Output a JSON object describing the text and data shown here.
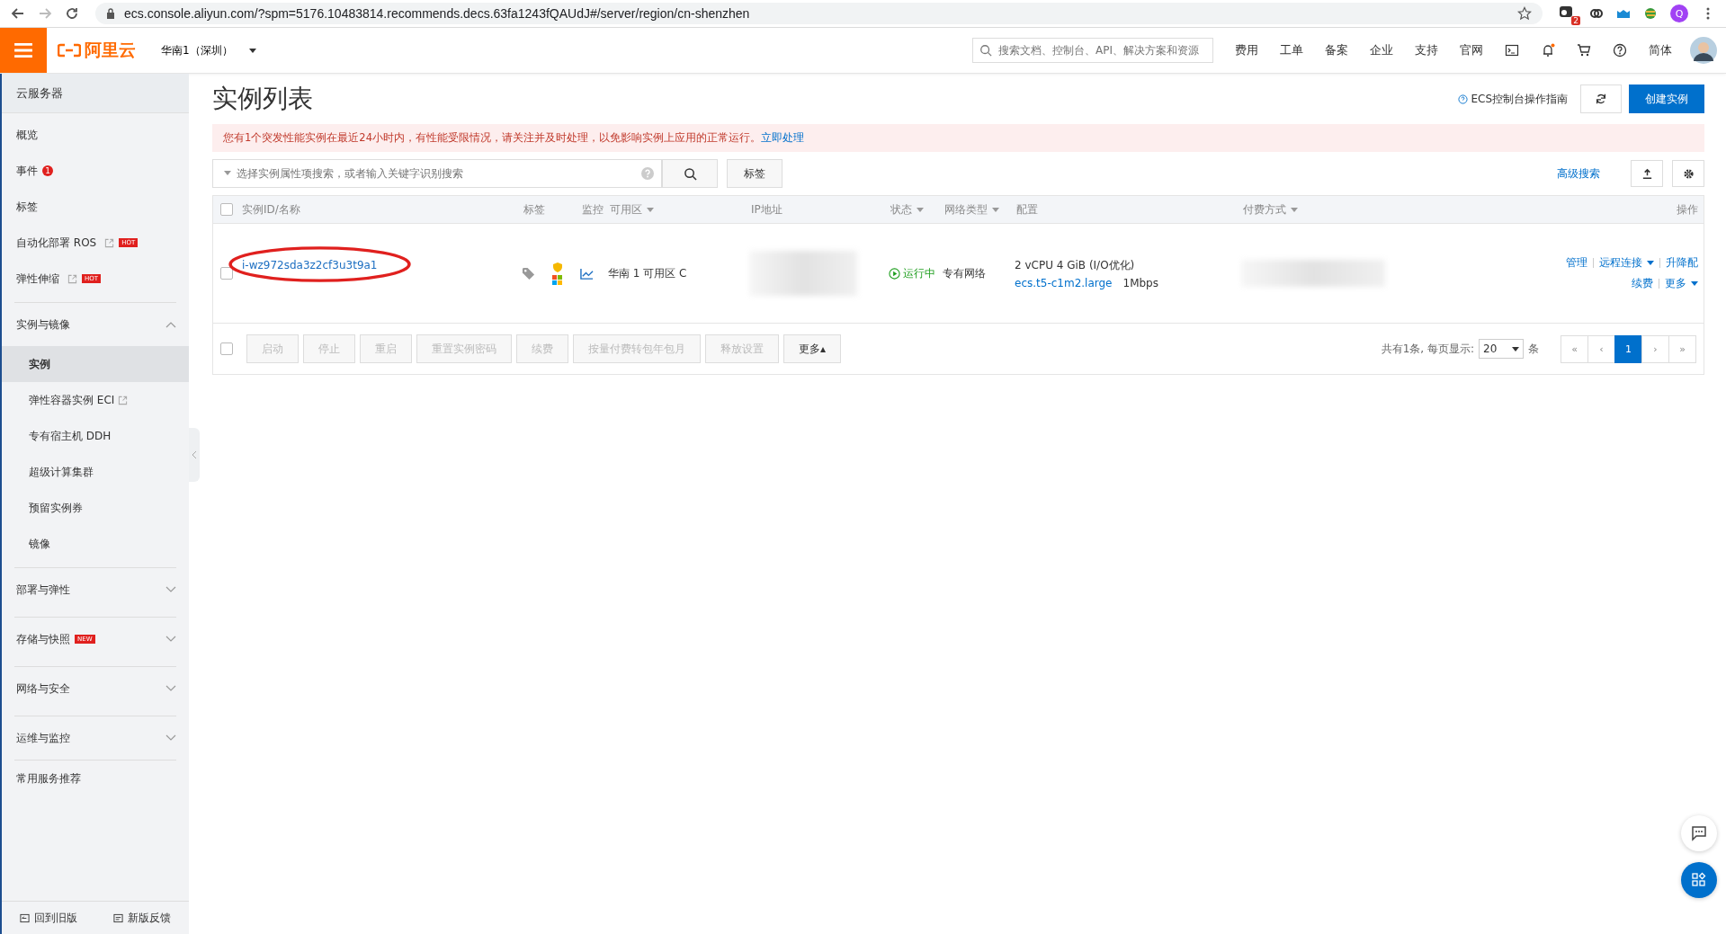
{
  "browser": {
    "url": "ecs.console.aliyun.com/?spm=5176.10483814.recommends.decs.63fa1243fQAUdJ#/server/region/cn-shenzhen",
    "extension_badge": "2",
    "profile_initial": "Q"
  },
  "topnav": {
    "logo": "阿里云",
    "region": "华南1（深圳）",
    "search_placeholder": "搜索文档、控制台、API、解决方案和资源",
    "links": [
      "费用",
      "工单",
      "备案",
      "企业",
      "支持",
      "官网"
    ],
    "language": "简体"
  },
  "sidebar": {
    "title": "云服务器",
    "items": [
      {
        "kind": "link",
        "label": "概览"
      },
      {
        "kind": "link",
        "label": "事件",
        "badge": "1"
      },
      {
        "kind": "link",
        "label": "标签"
      },
      {
        "kind": "link",
        "label": "自动化部署 ROS",
        "external": true,
        "tag": "HOT"
      },
      {
        "kind": "link",
        "label": "弹性伸缩",
        "external": true,
        "tag": "HOT"
      },
      {
        "kind": "group",
        "label": "实例与镜像",
        "expanded": true,
        "children": [
          {
            "label": "实例",
            "selected": true
          },
          {
            "label": "弹性容器实例 ECI",
            "selected": false,
            "external": true
          },
          {
            "label": "专有宿主机 DDH",
            "selected": false
          },
          {
            "label": "超级计算集群",
            "selected": false
          },
          {
            "label": "预留实例券",
            "selected": false
          },
          {
            "label": "镜像",
            "selected": false
          }
        ]
      },
      {
        "kind": "group",
        "label": "部署与弹性",
        "expanded": false
      },
      {
        "kind": "group",
        "label": "存储与快照",
        "expanded": false,
        "tag": "NEW"
      },
      {
        "kind": "group",
        "label": "网络与安全",
        "expanded": false
      },
      {
        "kind": "group",
        "label": "运维与监控",
        "expanded": false
      },
      {
        "kind": "link",
        "label": "常用服务推荐"
      }
    ],
    "footer": [
      "回到旧版",
      "新版反馈"
    ]
  },
  "page": {
    "title": "实例列表",
    "guide_link": "ECS控制台操作指南",
    "create_button": "创建实例",
    "alert": {
      "text": "您有1个突发性能实例在最近24小时内，有性能受限情况，请关注并及时处理，以免影响实例上应用的正常运行。",
      "link": "立即处理"
    },
    "search_placeholder": "选择实例属性项搜索，或者输入关键字识别搜索",
    "tag_button": "标签",
    "advanced_search": "高级搜索"
  },
  "table": {
    "header_checkbox": {
      "checked": false
    },
    "footer_checkbox": {
      "checked": false
    },
    "columns": [
      {
        "label": "实例ID/名称",
        "sortable": false
      },
      {
        "label": "标签",
        "sortable": false
      },
      {
        "label": "监控",
        "sortable": false
      },
      {
        "label": "可用区",
        "sortable": true
      },
      {
        "label": "IP地址",
        "sortable": false
      },
      {
        "label": "状态",
        "sortable": true
      },
      {
        "label": "网络类型",
        "sortable": true
      },
      {
        "label": "配置",
        "sortable": false
      },
      {
        "label": "付费方式",
        "sortable": true
      },
      {
        "label": "操作",
        "sortable": false
      }
    ],
    "rows": [
      {
        "selected": false,
        "annotated": true,
        "id": "i-wz972sda3z2cf3u3t9a1",
        "zone": "华南 1 可用区 C",
        "status": "运行中",
        "network": "专有网络",
        "config": "2 vCPU 4 GiB (I/O优化)",
        "instance_type": "ecs.t5-c1m2.large",
        "bandwidth": "1Mbps",
        "actions": [
          {
            "label": "管理",
            "dropdown": false
          },
          {
            "label": "远程连接",
            "dropdown": true
          },
          {
            "label": "升降配",
            "dropdown": false
          },
          {
            "label": "续费",
            "dropdown": false
          },
          {
            "label": "更多",
            "dropdown": true
          }
        ]
      }
    ],
    "bulk_buttons": [
      {
        "label": "启动",
        "disabled": true
      },
      {
        "label": "停止",
        "disabled": true
      },
      {
        "label": "重启",
        "disabled": true
      },
      {
        "label": "重置实例密码",
        "disabled": true
      },
      {
        "label": "续费",
        "disabled": true
      },
      {
        "label": "按量付费转包年包月",
        "disabled": true
      },
      {
        "label": "释放设置",
        "disabled": true
      },
      {
        "label": "更多▴",
        "disabled": false
      }
    ],
    "pagination": {
      "summary": "共有1条, 每页显示:",
      "page_size": "20",
      "unit": "条",
      "first": "«",
      "prev": "‹",
      "pages": [
        {
          "label": "1",
          "selected": true
        }
      ],
      "next": "›",
      "last": "»"
    }
  }
}
